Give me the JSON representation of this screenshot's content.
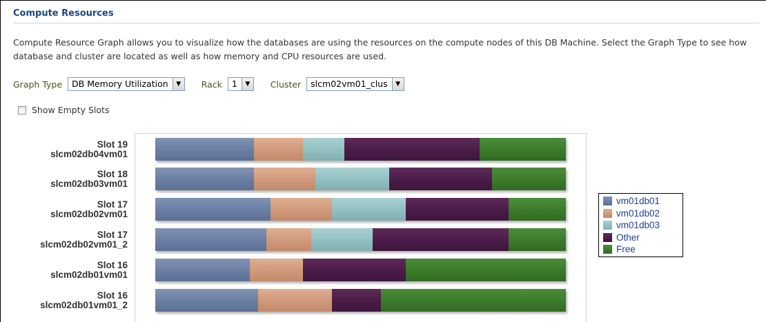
{
  "section": {
    "title": "Compute Resources",
    "description": "Compute Resource Graph allows you to visualize how the databases are using the resources on the compute nodes of this DB Machine. Select the Graph Type to see how database and cluster are located as well as how memory and CPU resources are used."
  },
  "controls": {
    "graph_type_label": "Graph Type",
    "graph_type_value": "DB Memory Utilization",
    "rack_label": "Rack",
    "rack_value": "1",
    "cluster_label": "Cluster",
    "cluster_value": "slcm02vm01_clus",
    "show_empty_slots_label": "Show Empty Slots",
    "show_empty_slots_checked": false
  },
  "icons": {
    "dropdown": "chevron-down-icon",
    "checkbox": "checkbox-icon"
  },
  "chart_data": {
    "type": "bar",
    "orientation": "horizontal",
    "stacked": true,
    "normalized": true,
    "categories": [
      [
        "Slot 19",
        "slcm02db04vm01"
      ],
      [
        "Slot 18",
        "slcm02db03vm01"
      ],
      [
        "Slot 17",
        "slcm02db02vm01"
      ],
      [
        "Slot 17",
        "slcm02db02vm01_2"
      ],
      [
        "Slot 16",
        "slcm02db01vm01"
      ],
      [
        "Slot 16",
        "slcm02db01vm01_2"
      ]
    ],
    "series": [
      {
        "name": "vm01db01",
        "key": "vm01db01",
        "color": "#6a7ea3",
        "values": [
          24,
          24,
          28,
          27,
          23,
          25
        ]
      },
      {
        "name": "vm01db02",
        "key": "vm01db02",
        "color": "#cf987a",
        "values": [
          12,
          15,
          15,
          11,
          13,
          18
        ]
      },
      {
        "name": "vm01db03",
        "key": "vm01db03",
        "color": "#91bfc0",
        "values": [
          10,
          18,
          18,
          15,
          0,
          0
        ]
      },
      {
        "name": "Other",
        "key": "other",
        "color": "#4a1c48",
        "values": [
          33,
          25,
          25,
          33,
          25,
          12
        ]
      },
      {
        "name": "Free",
        "key": "free",
        "color": "#3b7a2a",
        "values": [
          21,
          18,
          14,
          14,
          39,
          45
        ]
      }
    ],
    "legend_position": "right",
    "grid": false
  }
}
